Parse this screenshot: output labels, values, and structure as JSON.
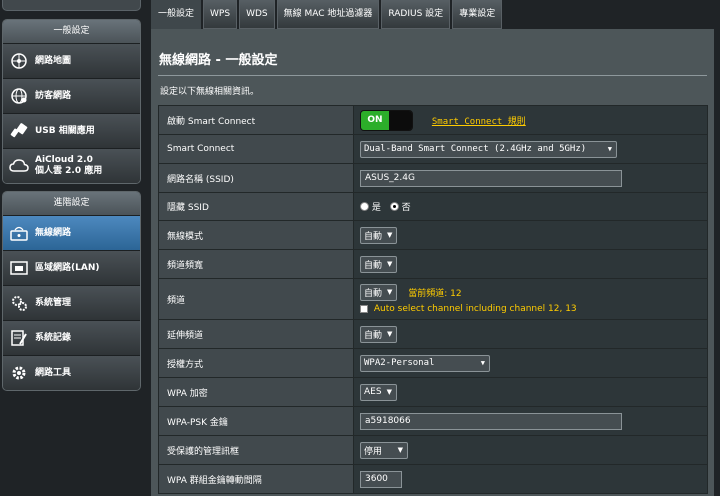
{
  "sidebar": {
    "group1": {
      "title": "一般設定",
      "items": [
        {
          "label": "網路地圖",
          "icon": "network-map-icon"
        },
        {
          "label": "訪客網路",
          "icon": "guest-network-icon"
        },
        {
          "label": "USB 相關應用",
          "icon": "usb-icon"
        },
        {
          "label": "AiCloud 2.0",
          "label2": "個人雲 2.0 應用",
          "icon": "cloud-icon"
        }
      ]
    },
    "group2": {
      "title": "進階設定",
      "items": [
        {
          "label": "無線網路",
          "icon": "wireless-icon",
          "active": true
        },
        {
          "label": "區域網路(LAN)",
          "icon": "lan-icon"
        },
        {
          "label": "系統管理",
          "icon": "admin-gear-icon"
        },
        {
          "label": "系統記錄",
          "icon": "system-log-icon"
        },
        {
          "label": "網路工具",
          "icon": "network-tools-icon"
        }
      ]
    }
  },
  "tabs": [
    {
      "label": "一般設定",
      "active": true
    },
    {
      "label": "WPS"
    },
    {
      "label": "WDS"
    },
    {
      "label": "無線 MAC 地址過濾器"
    },
    {
      "label": "RADIUS 設定"
    },
    {
      "label": "專業設定"
    }
  ],
  "panel": {
    "title": "無線網路 - 一般設定",
    "description": "設定以下無線相關資訊。"
  },
  "form": {
    "smart_connect_enable": {
      "label": "啟動 Smart Connect",
      "state": "ON",
      "link": "Smart Connect 規則"
    },
    "smart_connect": {
      "label": "Smart Connect",
      "value": "Dual-Band Smart Connect (2.4GHz and 5GHz)"
    },
    "ssid": {
      "label": "網路名稱 (SSID)",
      "value": "ASUS_2.4G"
    },
    "hide_ssid": {
      "label": "隱藏 SSID",
      "yes": "是",
      "no": "否",
      "selected": "no"
    },
    "wireless_mode": {
      "label": "無線模式",
      "value": "自動"
    },
    "bandwidth": {
      "label": "頻道頻寬",
      "value": "自動"
    },
    "channel": {
      "label": "頻道",
      "value": "自動",
      "current": "當前頻道: 12",
      "checkbox_label": "Auto select channel including channel 12, 13"
    },
    "extension_channel": {
      "label": "延伸頻道",
      "value": "自動"
    },
    "auth_method": {
      "label": "授權方式",
      "value": "WPA2-Personal"
    },
    "wpa_encryption": {
      "label": "WPA 加密",
      "value": "AES"
    },
    "wpa_psk": {
      "label": "WPA-PSK 金鑰",
      "value": "a5918066"
    },
    "pmf": {
      "label": "受保護的管理訊框",
      "value": "停用"
    },
    "group_key_interval": {
      "label": "WPA 群組金鑰轉動間隔",
      "value": "3600"
    }
  },
  "colors": {
    "accent_active": "#3a77ad",
    "toggle_on": "#2cae2a",
    "highlight_text": "#ffcc00"
  }
}
